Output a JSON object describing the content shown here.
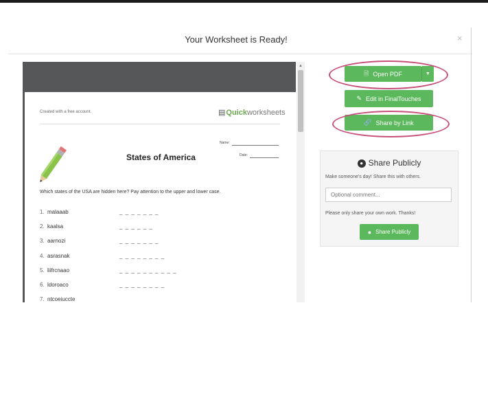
{
  "modal": {
    "title": "Your Worksheet is Ready!",
    "close": "×"
  },
  "preview": {
    "created_with": "Created with a free account.",
    "brand_part1": "Quick",
    "brand_part2": "worksheets",
    "name_label": "Name:",
    "date_label": "Date:",
    "title": "States of America",
    "instructions": "Which states of the USA are hidden here? Pay attention to the upper and lower case.",
    "words": [
      {
        "num": "1.",
        "word": "malaaab",
        "blanks": "_ _ _ _ _ _ _"
      },
      {
        "num": "2.",
        "word": "kaalsa",
        "blanks": "_ _ _ _ _ _"
      },
      {
        "num": "3.",
        "word": "aarnozi",
        "blanks": "_ _ _ _ _ _ _"
      },
      {
        "num": "4.",
        "word": "asrasnak",
        "blanks": "_ _ _ _ _ _ _ _"
      },
      {
        "num": "5.",
        "word": "liifrcnaao",
        "blanks": "_ _ _ _ _ _ _ _ _ _"
      },
      {
        "num": "6.",
        "word": "ldoroaco",
        "blanks": "_ _ _ _ _ _ _ _"
      },
      {
        "num": "7.",
        "word": "ntcoeiuccte",
        "blanks": ""
      }
    ]
  },
  "actions": {
    "open_pdf": "Open PDF",
    "caret": "▼",
    "edit": "Edit in FinalTouches",
    "share_link": "Share by Link"
  },
  "share_panel": {
    "title": "Share Publicly",
    "subtitle": "Make someone's day! Share this with others.",
    "comment_placeholder": "Optional comment...",
    "note": "Please only share your own work. Thanks!",
    "button": "Share Publicly"
  },
  "colors": {
    "button_green": "#5cb85c",
    "highlight_oval": "#c64f7a",
    "brand_green": "#6aa84f",
    "preview_bg": "#555758"
  }
}
